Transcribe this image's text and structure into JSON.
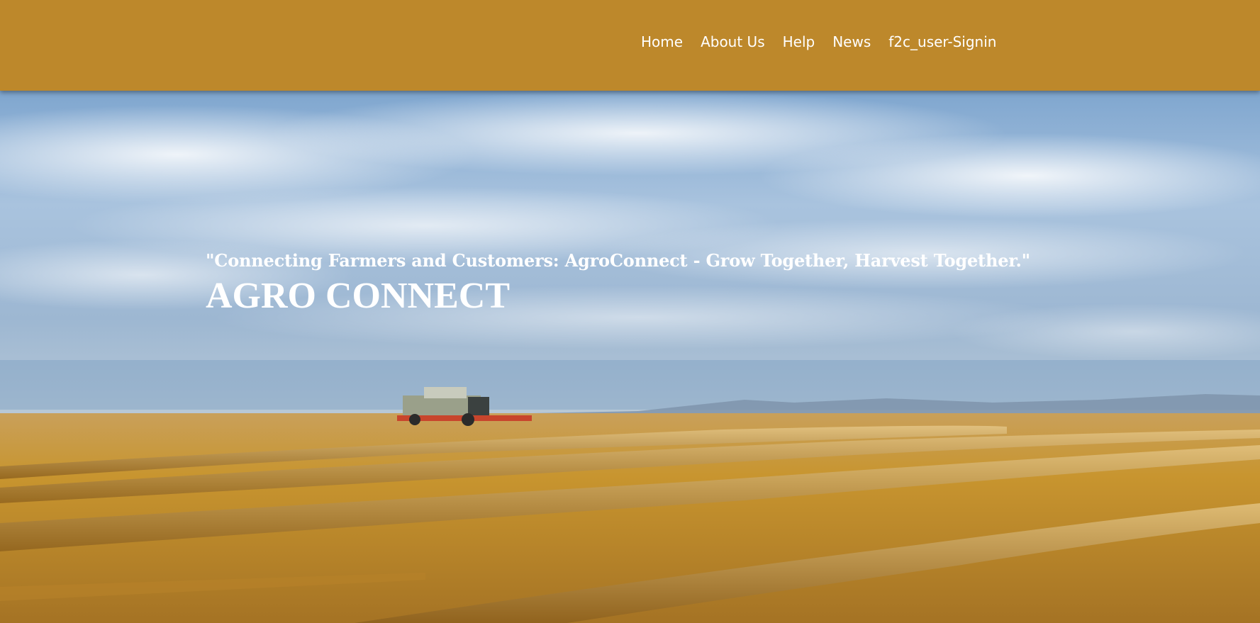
{
  "nav": {
    "items": [
      {
        "label": "Home"
      },
      {
        "label": "About Us"
      },
      {
        "label": "Help"
      },
      {
        "label": "News"
      },
      {
        "label": "f2c_user-Signin"
      }
    ]
  },
  "hero": {
    "tagline": "\"Connecting Farmers and Customers: AgroConnect - Grow Together, Harvest Together.\"",
    "title": "AGRO CONNECT"
  },
  "colors": {
    "navbar": "#bd882b",
    "text": "#ffffff"
  }
}
